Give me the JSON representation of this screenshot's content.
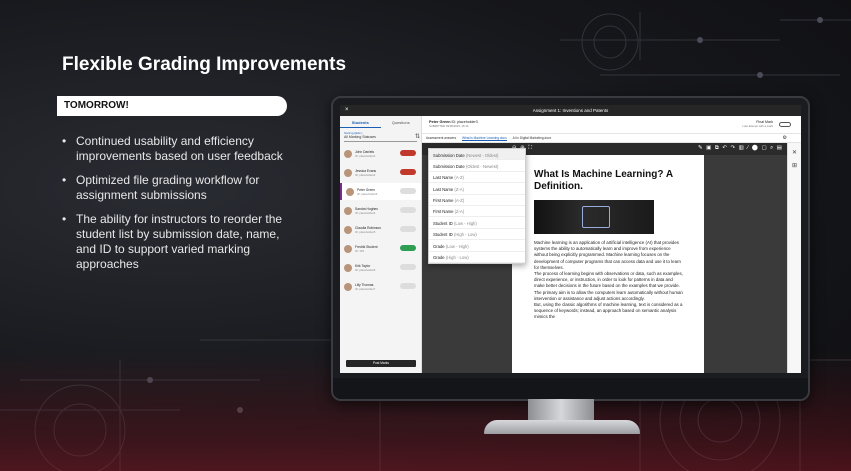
{
  "slide": {
    "title": "Flexible Grading Improvements",
    "banner": "TOMORROW!",
    "bullets": [
      "Continued usability and efficiency improvements based on user feedback",
      "Optimized file grading workflow for assignment submissions",
      "The ability for instructors to reorder the student list by submission date, name, and ID to support varied marking approaches"
    ]
  },
  "app": {
    "window_title": "Assignment 1: Inventions and Patents",
    "close_glyph": "×",
    "tabs": [
      "Students",
      "Questions"
    ],
    "sort_label": "Sorting (Eds.)",
    "sort_value": "All Marking Statuses",
    "students": [
      {
        "name": "John Daniels",
        "sub": "ID: placeholder1",
        "status": "",
        "tone": "red"
      },
      {
        "name": "Jessica Evans",
        "sub": "ID: placeholder2",
        "status": "",
        "tone": "red"
      },
      {
        "name": "Peter Green",
        "sub": "ID: placeholder3",
        "status": "",
        "tone": "grey"
      },
      {
        "name": "Sandra Hughes",
        "sub": "ID: placeholder4",
        "status": "",
        "tone": "grey"
      },
      {
        "name": "Claudia Robinson",
        "sub": "ID: placeholder5",
        "status": "",
        "tone": "grey"
      },
      {
        "name": "Fredrik Student",
        "sub": "ID: 145",
        "status": "",
        "tone": "green"
      },
      {
        "name": "Kirk Taylor",
        "sub": "ID: placeholder6",
        "status": "",
        "tone": "grey"
      },
      {
        "name": "Lilly Thomas",
        "sub": "ID: placeholder7",
        "status": "",
        "tone": "grey"
      }
    ],
    "post_button": "Post Marks",
    "header": {
      "student": "Peter Green",
      "student_meta": "ID: placeholder3",
      "submitted": "SUBMITTED 09/05/2023, 15:14",
      "final_mark": "Final Mark",
      "final_sub": "Last attempt with a mark"
    },
    "doc_tabs": [
      "Assessment answers",
      "What is Machine Learning.docx",
      "AI in Digital Marketing.docx"
    ],
    "toolbar_left": "⊖ ⊕ ⛶",
    "toolbar_right": "✎ ▣ ⧉ ↶ ↷ ▥ ∕ ⬤ ▢ ⌕ ▤",
    "sort_options": [
      {
        "label": "Submission Date",
        "hint": "(Newest - Oldest)"
      },
      {
        "label": "Submission Date",
        "hint": "(Oldest - Newest)"
      },
      {
        "label": "Last Name",
        "hint": "(A-Z)"
      },
      {
        "label": "Last Name",
        "hint": "(Z-A)"
      },
      {
        "label": "First Name",
        "hint": "(A-Z)"
      },
      {
        "label": "First Name",
        "hint": "(Z-A)"
      },
      {
        "label": "Student ID",
        "hint": "(Low - High)"
      },
      {
        "label": "Student ID",
        "hint": "(High - Low)"
      },
      {
        "label": "Grade",
        "hint": "(Low - High)"
      },
      {
        "label": "Grade",
        "hint": "(High - Low)"
      }
    ],
    "document": {
      "heading": "What Is Machine Learning? A Definition.",
      "body": [
        "Machine learning is an application of artificial intelligence (AI) that provides systems the ability to automatically learn and improve from experience without being explicitly programmed. Machine learning focuses on the development of computer programs that can access data and use it to learn for themselves.",
        "The process of learning begins with observations or data, such as examples, direct experience, or instruction, in order to look for patterns in data and make better decisions in the future based on the examples that we provide. The primary aim is to allow the computers learn automatically without human intervention or assistance and adjust actions accordingly.",
        "But, using the classic algorithms of machine learning, text is considered as a sequence of keywords; instead, an approach based on semantic analysis mimics the"
      ]
    }
  }
}
